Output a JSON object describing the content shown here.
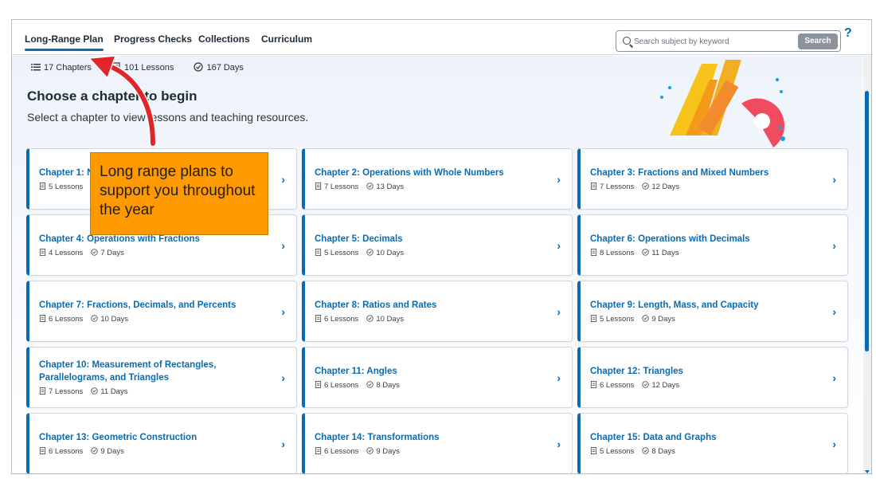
{
  "nav": {
    "tabs": [
      {
        "label": "Long-Range Plan",
        "active": true
      },
      {
        "label": "Progress Checks"
      },
      {
        "label": "Collections"
      },
      {
        "label": "Curriculum"
      }
    ],
    "search_placeholder": "Search subject by keyword",
    "search_button": "Search",
    "help_label": "?"
  },
  "stats": {
    "chapters": "17 Chapters",
    "lessons": "101 Lessons",
    "days": "167 Days"
  },
  "heading": {
    "title": "Choose a chapter to begin",
    "subtitle": "Select a chapter to view lessons and teaching resources."
  },
  "chapters": [
    {
      "title": "Chapter 1: Number Sense",
      "lessons": "5 Lessons",
      "days": ""
    },
    {
      "title": "Chapter 2: Operations with Whole Numbers",
      "lessons": "7 Lessons",
      "days": "13 Days"
    },
    {
      "title": "Chapter 3: Fractions and Mixed Numbers",
      "lessons": "7 Lessons",
      "days": "12 Days"
    },
    {
      "title": "Chapter 4: Operations with Fractions",
      "lessons": "4 Lessons",
      "days": "7 Days"
    },
    {
      "title": "Chapter 5: Decimals",
      "lessons": "5 Lessons",
      "days": "10 Days"
    },
    {
      "title": "Chapter 6: Operations with Decimals",
      "lessons": "8 Lessons",
      "days": "11 Days"
    },
    {
      "title": "Chapter 7: Fractions, Decimals, and Percents",
      "lessons": "6 Lessons",
      "days": "10 Days"
    },
    {
      "title": "Chapter 8: Ratios and Rates",
      "lessons": "6 Lessons",
      "days": "10 Days"
    },
    {
      "title": "Chapter 9: Length, Mass, and Capacity",
      "lessons": "5 Lessons",
      "days": "9 Days"
    },
    {
      "title": "Chapter 10: Measurement of Rectangles, Parallelograms, and Triangles",
      "lessons": "7 Lessons",
      "days": "11 Days"
    },
    {
      "title": "Chapter 11: Angles",
      "lessons": "6 Lessons",
      "days": "8 Days"
    },
    {
      "title": "Chapter 12: Triangles",
      "lessons": "6 Lessons",
      "days": "12 Days"
    },
    {
      "title": "Chapter 13: Geometric Construction",
      "lessons": "6 Lessons",
      "days": "9 Days"
    },
    {
      "title": "Chapter 14: Transformations",
      "lessons": "6 Lessons",
      "days": "9 Days"
    },
    {
      "title": "Chapter 15: Data and Graphs",
      "lessons": "5 Lessons",
      "days": "8 Days"
    }
  ],
  "callout": {
    "text": "Long range plans to support you throughout the year"
  },
  "colors": {
    "accent": "#0a6bb3",
    "callout": "#ff9900",
    "arrow": "#e0262b"
  }
}
